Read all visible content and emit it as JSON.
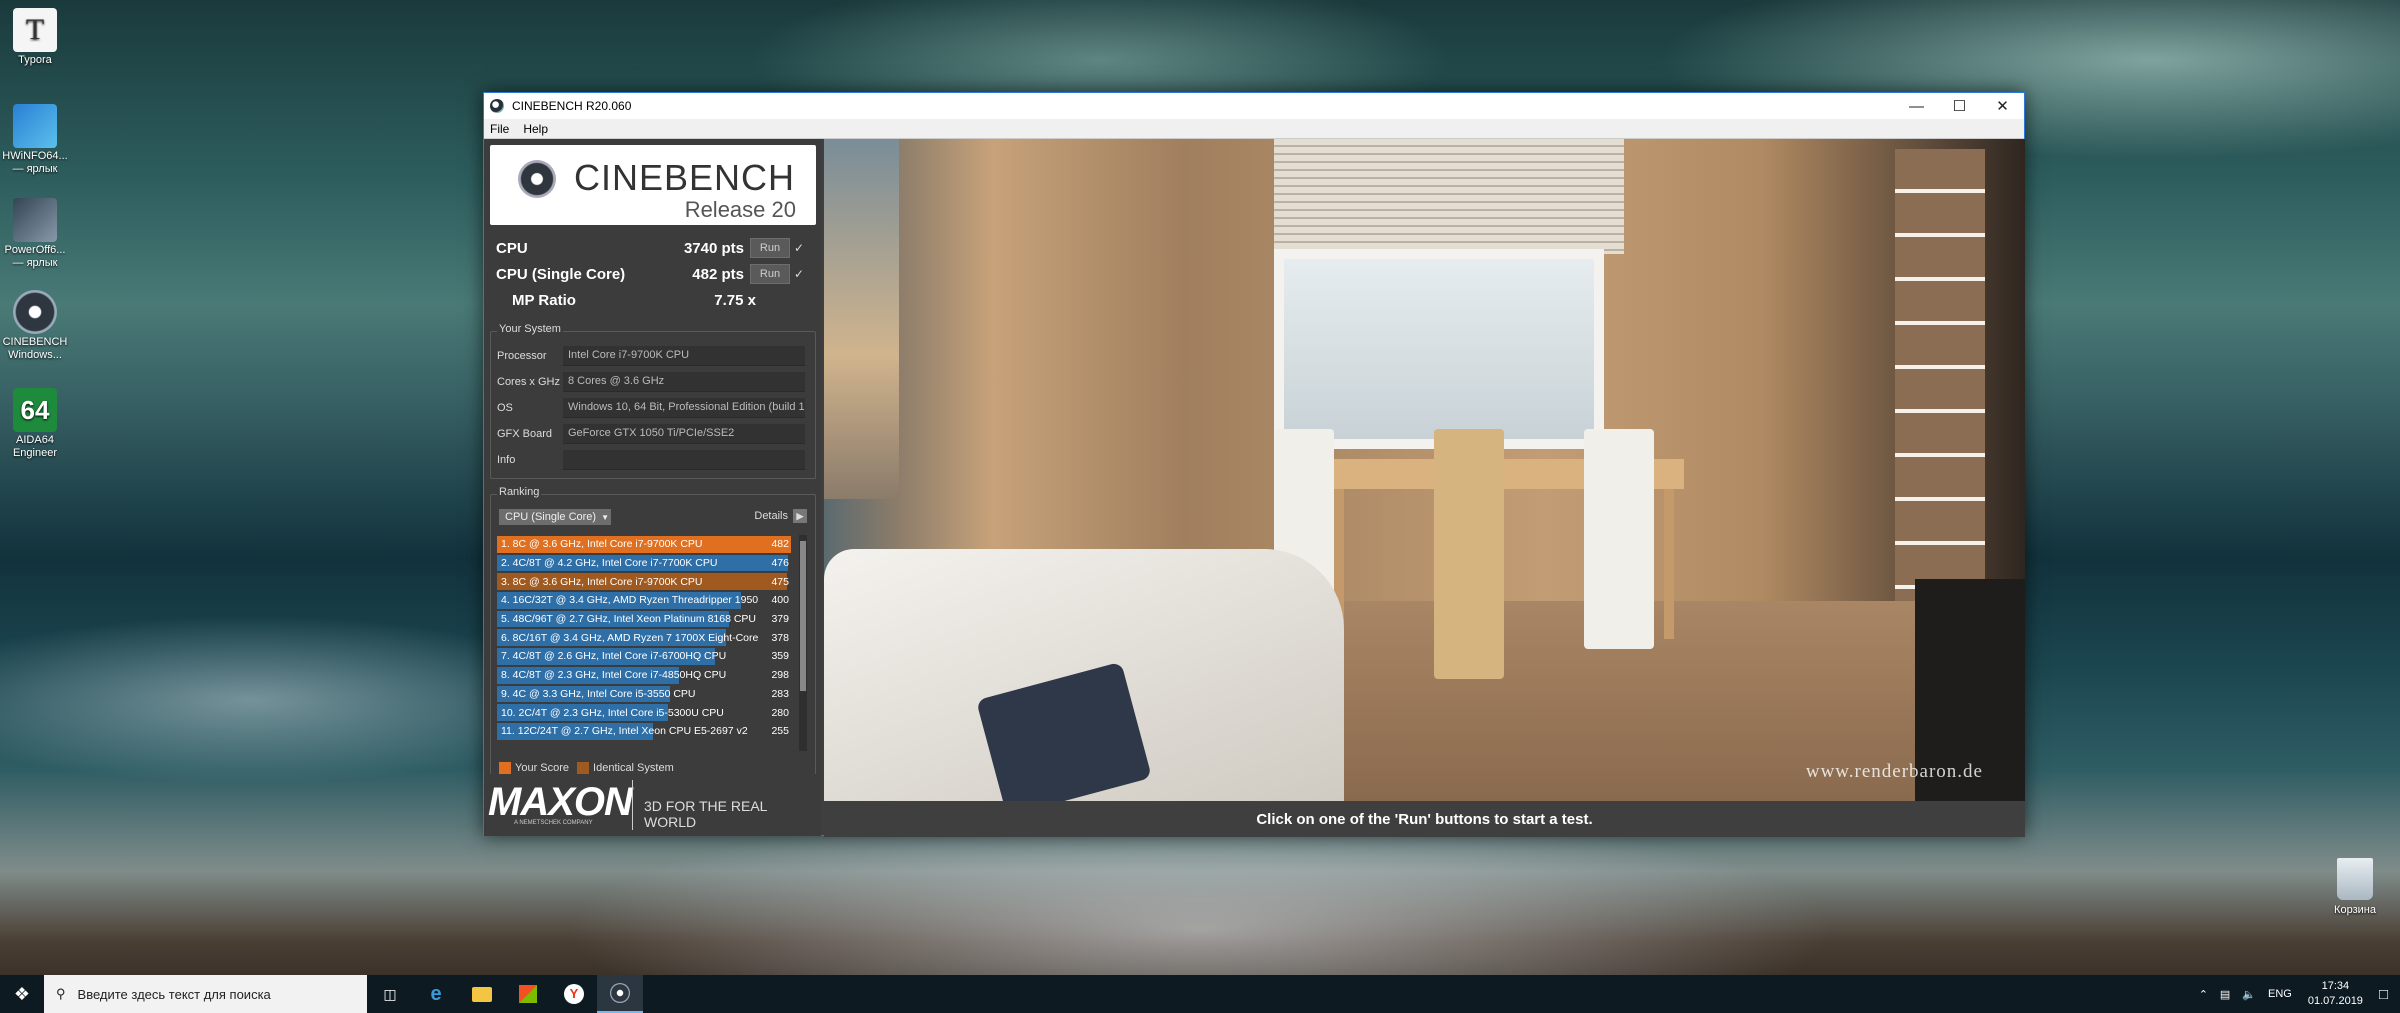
{
  "desktop": {
    "icons": [
      {
        "label": "Typora"
      },
      {
        "label": "HWiNFO64... — ярлык"
      },
      {
        "label": "PowerOff6... — ярлык"
      },
      {
        "label": "CINEBENCH Windows..."
      },
      {
        "label": "AIDA64 Engineer"
      }
    ],
    "recycle_bin": "Корзина"
  },
  "window": {
    "title": "CINEBENCH R20.060",
    "menu": [
      "File",
      "Help"
    ]
  },
  "header": {
    "brand": "CINEBENCH",
    "release": "Release 20"
  },
  "scores": {
    "cpu": {
      "label": "CPU",
      "value": "3740 pts",
      "run": "Run"
    },
    "single": {
      "label": "CPU (Single Core)",
      "value": "482 pts",
      "run": "Run"
    },
    "ratio": {
      "label": "MP Ratio",
      "value": "7.75 x"
    }
  },
  "system": {
    "title": "Your System",
    "rows": [
      {
        "k": "Processor",
        "v": "Intel Core i7-9700K CPU"
      },
      {
        "k": "Cores x GHz",
        "v": "8 Cores @ 3.6 GHz"
      },
      {
        "k": "OS",
        "v": "Windows 10, 64 Bit, Professional Edition (build 1"
      },
      {
        "k": "GFX Board",
        "v": "GeForce GTX 1050 Ti/PCIe/SSE2"
      },
      {
        "k": "Info",
        "v": ""
      }
    ]
  },
  "ranking": {
    "title": "Ranking",
    "select": "CPU (Single Core)",
    "details": "Details",
    "rows": [
      {
        "t": "1. 8C @ 3.6 GHz, Intel Core i7-9700K CPU",
        "s": "482",
        "kind": "you",
        "frac": 1.0
      },
      {
        "t": "2. 4C/8T @ 4.2 GHz, Intel Core i7-7700K CPU",
        "s": "476",
        "kind": "other",
        "frac": 0.99
      },
      {
        "t": "3. 8C @ 3.6 GHz, Intel Core i7-9700K CPU",
        "s": "475",
        "kind": "ident",
        "frac": 0.985
      },
      {
        "t": "4. 16C/32T @ 3.4 GHz, AMD Ryzen Threadripper 1950",
        "s": "400",
        "kind": "other",
        "frac": 0.83
      },
      {
        "t": "5. 48C/96T @ 2.7 GHz, Intel Xeon Platinum 8168 CPU",
        "s": "379",
        "kind": "other",
        "frac": 0.79
      },
      {
        "t": "6. 8C/16T @ 3.4 GHz, AMD Ryzen 7 1700X Eight-Core",
        "s": "378",
        "kind": "other",
        "frac": 0.78
      },
      {
        "t": "7. 4C/8T @ 2.6 GHz, Intel Core i7-6700HQ CPU",
        "s": "359",
        "kind": "other",
        "frac": 0.74
      },
      {
        "t": "8. 4C/8T @ 2.3 GHz, Intel Core i7-4850HQ CPU",
        "s": "298",
        "kind": "other",
        "frac": 0.62
      },
      {
        "t": "9. 4C @ 3.3 GHz, Intel Core i5-3550 CPU",
        "s": "283",
        "kind": "other",
        "frac": 0.59
      },
      {
        "t": "10. 2C/4T @ 2.3 GHz, Intel Core i5-5300U CPU",
        "s": "280",
        "kind": "other",
        "frac": 0.58
      },
      {
        "t": "11. 12C/24T @ 2.7 GHz, Intel Xeon CPU E5-2697 v2",
        "s": "255",
        "kind": "other",
        "frac": 0.53
      }
    ],
    "legend": {
      "you": "Your Score",
      "ident": "Identical System"
    }
  },
  "footer": {
    "maxon": "MAXON",
    "maxon_sub": "A NEMETSCHEK COMPANY",
    "tagline": "3D FOR THE REAL WORLD"
  },
  "render": {
    "watermark": "www.renderbaron.de"
  },
  "status": "Click on one of the 'Run' buttons to start a test.",
  "taskbar": {
    "search_placeholder": "Введите здесь текст для поиска",
    "lang": "ENG",
    "time": "17:34",
    "date": "01.07.2019"
  },
  "colors": {
    "you": "#e07020",
    "ident": "#a05a20",
    "other": "#2f6fa8",
    "accent": "#2b79d6"
  }
}
